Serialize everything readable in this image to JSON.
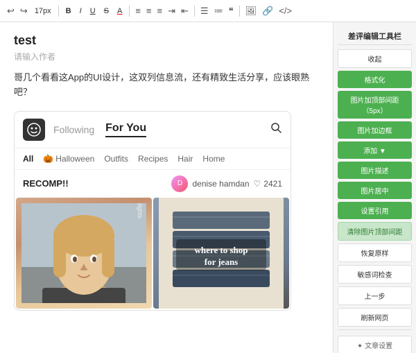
{
  "toolbar": {
    "font_size": "17px",
    "bold": "B",
    "italic": "I",
    "underline": "U",
    "strikethrough": "S",
    "color": "A",
    "more_icons": "..."
  },
  "post": {
    "title": "test",
    "subtitle": "请输入作者",
    "description": "哥几个看看这App的UI设计，这双列信息流，还有精致生活分享，应该眼熟吧？"
  },
  "app": {
    "logo_icon": "face-icon",
    "nav": {
      "following": "Following",
      "for_you": "For You",
      "search_icon": "search-icon"
    },
    "categories": [
      "All",
      "Halloween",
      "Outfits",
      "Recipes",
      "Hair",
      "Home"
    ],
    "post_label": "RECOMP!!",
    "user_name": "denise hamdan",
    "likes": "2421",
    "card_right_text": "where to shop\nfor jeans",
    "card_left_overlay": "fresh Haircut highlights"
  },
  "right_sidebar": {
    "title": "差评编辑工具栏",
    "collapse": "收起",
    "buttons": [
      {
        "label": "格式化",
        "style": "green"
      },
      {
        "label": "图片加顶部间距（5px）",
        "style": "green"
      },
      {
        "label": "图片加边框",
        "style": "green"
      },
      {
        "label": "添加 ▼",
        "style": "green"
      },
      {
        "label": "图片描述",
        "style": "green"
      },
      {
        "label": "图片居中",
        "style": "green"
      },
      {
        "label": "设置引用",
        "style": "green"
      },
      {
        "label": "清除图片顶部间距",
        "style": "light-green"
      },
      {
        "label": "恢复原样",
        "style": "white"
      },
      {
        "label": "敏感词检查",
        "style": "white"
      },
      {
        "label": "上一步",
        "style": "white"
      },
      {
        "label": "刷新网页",
        "style": "white"
      }
    ],
    "bottom": "✦ 文章设置"
  }
}
